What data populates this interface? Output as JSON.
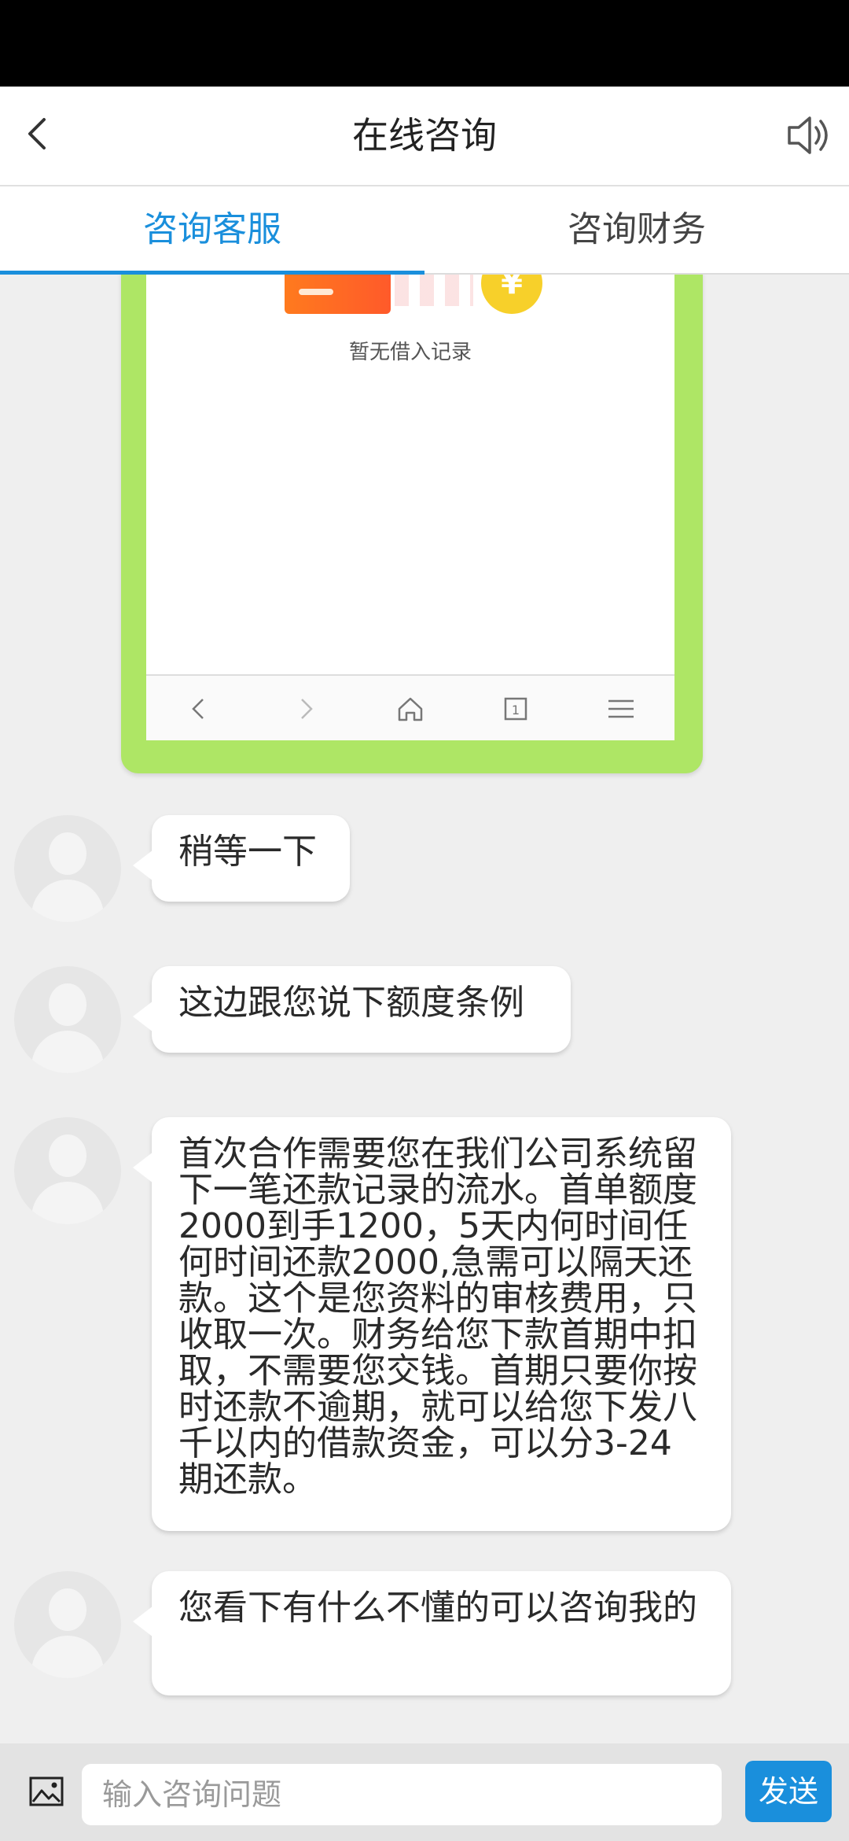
{
  "header": {
    "title": "在线咨询",
    "back_icon": "chevron-left-icon",
    "sound_icon": "speaker-icon"
  },
  "tabs": [
    {
      "label": "咨询客服",
      "active": true
    },
    {
      "label": "咨询财务",
      "active": false
    }
  ],
  "image_message": {
    "no_record_text": "暂无借入记录",
    "coin_symbol": "¥",
    "browser_icons": [
      "back-icon",
      "forward-icon",
      "home-icon",
      "tabs-icon",
      "menu-icon"
    ],
    "tab_count": "1"
  },
  "messages": [
    {
      "text": "稍等一下"
    },
    {
      "text": "这边跟您说下额度条例"
    },
    {
      "text": "首次合作需要您在我们公司系统留下一笔还款记录的流水。首单额度2000到手1200，5天内何时间任何时间还款2000,急需可以隔天还款。这个是您资料的审核费用，只收取一次。财务给您下款首期中扣取，不需要您交钱。首期只要你按时还款不逾期，就可以给您下发八千以内的借款资金，可以分3-24期还款。"
    },
    {
      "text": "您看下有什么不懂的可以咨询我的"
    }
  ],
  "input": {
    "placeholder": "输入咨询问题",
    "value": "",
    "send_label": "发送",
    "image_icon": "image-icon"
  },
  "colors": {
    "accent": "#1a8fdc",
    "image_frame": "#aee665",
    "background": "#efefef"
  }
}
